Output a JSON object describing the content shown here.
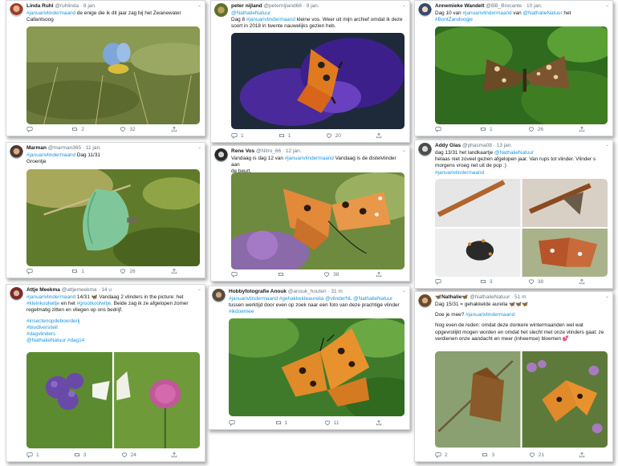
{
  "tweets": [
    {
      "name": "Linda Ruhl",
      "handle": "@ruhlinda",
      "time": "8 jan.",
      "lines": [
        "#januarivlindermaand de enige die ik dit jaar zag bij het Zwanewater",
        "Callantsoog"
      ],
      "replies": "",
      "retweets": "2",
      "likes": "32",
      "photo": "Blue butterfly on grass"
    },
    {
      "name": "peter nijland",
      "handle": "@peternijland68",
      "time": "9 jan.",
      "lines": [
        "@NathalieNatuur",
        "Dag 8 #januarivlindermaand kleine vos. Weer uit mijn archief omdat ik deze",
        "soort in 2018 in twente nauwelijks gezien heb."
      ],
      "replies": "1",
      "retweets": "1",
      "likes": "20",
      "photo": "Small tortoiseshell on purple flower"
    },
    {
      "name": "Annemieke Wandelt",
      "handle": "@BB_Brocante",
      "time": "10 jan.",
      "lines": [
        "Dag 10 van #januarivlindermaand van @NathalieNatuur het",
        "#BontZandoogje"
      ],
      "replies": "",
      "retweets": "1",
      "likes": "26",
      "photo": "Speckled wood on leaves"
    },
    {
      "name": "Marman",
      "handle": "@marman365",
      "time": "11 jan.",
      "lines": [
        "#januarivlindermaand Dag 11/31",
        "Groentje"
      ],
      "replies": "",
      "retweets": "1",
      "likes": "26",
      "photo": "Green hairstreak on twig"
    },
    {
      "name": "Rene Vos",
      "handle": "@Nitro_66",
      "time": "12 jan.",
      "lines": [
        "Vandaag is dag 12 van #januarivlindermaand Vandaag is de distelvlinder aan",
        "de beurt."
      ],
      "replies": "",
      "retweets": "",
      "likes": "38",
      "photo": "Painted lady on thistle"
    },
    {
      "name": "Addy Glas",
      "handle": "@phasma08",
      "time": "13 jan.",
      "lines": [
        "dag 13/31 het landkaartje @NathalieNatuur",
        "helaas niet zoveel gezien afgelopen jaar. Van rups tot vlinder. Vlinder s",
        "morgens vroeg net uit de pop :)",
        "#januarivlindermaand"
      ],
      "replies": "",
      "retweets": "3",
      "likes": "38",
      "photo": "Map butterfly life cycle"
    },
    {
      "name": "Attje Meekma",
      "handle": "@attjemeekma",
      "time": "14 u",
      "lines": [
        "#januarivlindermaand 14/31 🦋 Vandaag 2 vlinders in the picture: het",
        "#kleinkoolwitje en het #grootkoolwitje. Beide zag ik ze afgelopen zomer",
        "regelmatig zitten en vliegen op ons bedrijf.",
        "",
        "#insectenopdeboerderij",
        "#biodiversiteit",
        "#dagvlinders",
        "@NathalieNatuur #dag14"
      ],
      "replies": "1",
      "retweets": "3",
      "likes": "24",
      "photo": "Whites on phacelia and clover"
    },
    {
      "name": "Hobbyfotografie Anouk",
      "handle": "@anouk_houten",
      "time": "31 m",
      "lines": [
        "#januarivlindermaand #gehakkeldeaurelia @vlinderNL @NathalieNatuur",
        "tussen werktijd door even op zoek naar een foto van deze prachtige vlinder",
        "#ikdoemee"
      ],
      "replies": "",
      "retweets": "1",
      "likes": "11",
      "photo": "Comma butterfly on leaves"
    },
    {
      "name": "🦋Nathalie🦋",
      "handle": "@NathalieNatuur",
      "time": "51 m",
      "lines": [
        "Doe je mee? #januarivlindermaand",
        "",
        "Nog even de reden: omdat deze donkere wintermaanden wel wat",
        "opgevrolijkt mogen worden en omdat het slecht met onze vlinders gaat: ze",
        "verdienen onze aandacht en meer (inheemse) bloemen 💕"
      ],
      "extra": "Dag 15/31 = gehakkelde aurelia 🦋🦋🦋",
      "replies": "2",
      "retweets": "3",
      "likes": "21",
      "photo": "Comma butterflies on flowers"
    }
  ],
  "colors": {
    "link": "#1b95e0",
    "muted": "#657786",
    "border": "#d5d8dc"
  },
  "icons": [
    "reply-icon",
    "retweet-icon",
    "like-icon",
    "share-icon",
    "chevron-down-icon"
  ]
}
